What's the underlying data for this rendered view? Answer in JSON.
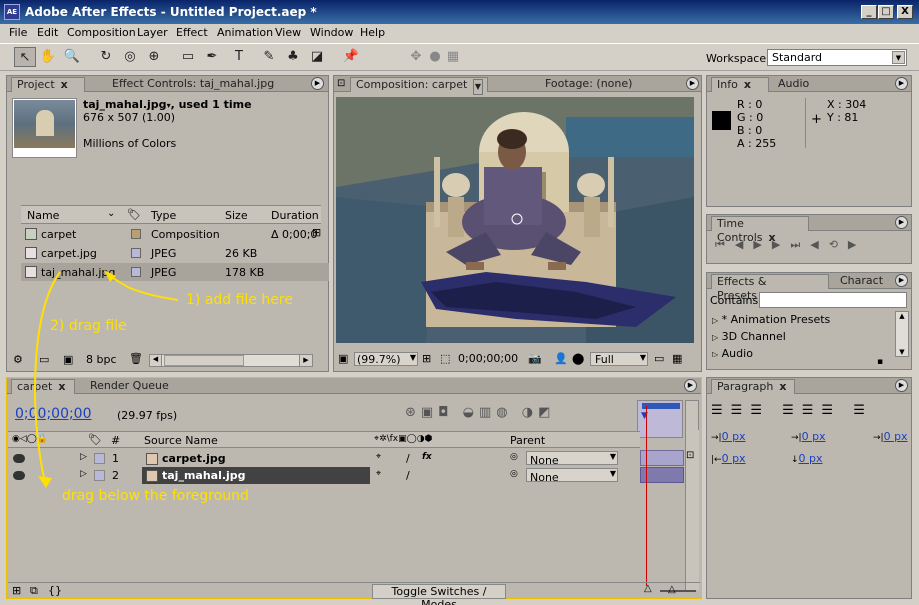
{
  "window": {
    "title": "Adobe After Effects - Untitled Project.aep *",
    "app_icon": "AE",
    "min": "_",
    "max": "□",
    "close": "X"
  },
  "menu": [
    "File",
    "Edit",
    "Composition",
    "Layer",
    "Effect",
    "Animation",
    "View",
    "Window",
    "Help"
  ],
  "toolbar": {
    "workspace_label": "Workspace:",
    "workspace_value": "Standard"
  },
  "project": {
    "tab_project": "Project",
    "tab_effects": "Effect Controls: taj_mahal.jpg",
    "info_name": "taj_mahal.jpg",
    "info_used": ", used 1 time",
    "info_dims": "676 x 507 (1.00)",
    "info_colors": "Millions of Colors",
    "columns": [
      "Name",
      "Type",
      "Size",
      "Duration"
    ],
    "rows": [
      {
        "name": "carpet",
        "type": "Composition",
        "size": "",
        "duration": "Δ 0;00;0",
        "color": "#b8a070"
      },
      {
        "name": "carpet.jpg",
        "type": "JPEG",
        "size": "26 KB",
        "duration": "",
        "color": "#b8b8d8"
      },
      {
        "name": "taj_mahal.jpg",
        "type": "JPEG",
        "size": "178 KB",
        "duration": "",
        "color": "#b8b8d8"
      }
    ],
    "bpc": "8 bpc"
  },
  "composition": {
    "tab_comp": "Composition: carpet",
    "tab_footage": "Footage: (none)",
    "zoom": "(99.7%)",
    "timecode": "0;00;00;00",
    "resolution": "Full"
  },
  "info": {
    "tab_info": "Info",
    "tab_audio": "Audio",
    "r": "R : 0",
    "g": "G : 0",
    "b": "B : 0",
    "a": "A : 255",
    "x": "X : 304",
    "y": "Y : 81",
    "swatch": "#000000"
  },
  "time_controls": {
    "title": "Time Controls"
  },
  "effects": {
    "tab_effects": "Effects & Presets",
    "tab_character": "Charact",
    "contains_label": "Contains:",
    "items": [
      "* Animation Presets",
      "3D Channel",
      "Audio"
    ]
  },
  "timeline": {
    "tab_comp": "carpet",
    "tab_render": "Render Queue",
    "timecode": "0;00;00;00",
    "fps": "(29.97 fps)",
    "col_num": "#",
    "col_source": "Source Name",
    "col_parent": "Parent",
    "layers": [
      {
        "num": "1",
        "name": "carpet.jpg",
        "parent": "None"
      },
      {
        "num": "2",
        "name": "taj_mahal.jpg",
        "parent": "None"
      }
    ],
    "toggle": "Toggle Switches / Modes"
  },
  "paragraph": {
    "tab": "Paragraph",
    "indent_left": "0 px",
    "indent_right": "0 px",
    "indent_first": "0 px",
    "space_before": "0 px",
    "space_after": "0 px"
  },
  "annotations": {
    "add": "1) add file here",
    "drag": "2) drag file",
    "below": "drag below the foreground"
  }
}
